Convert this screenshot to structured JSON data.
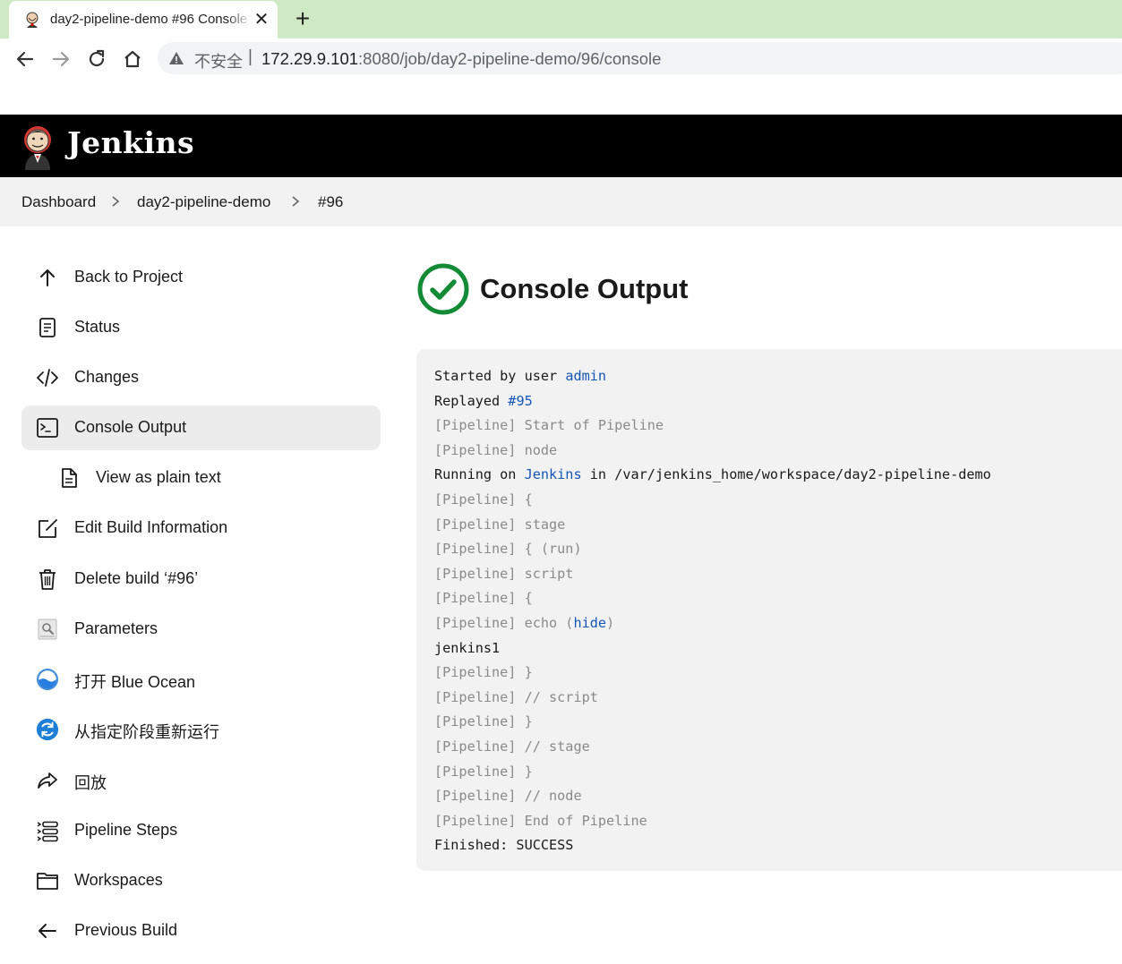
{
  "browser": {
    "tab_title": "day2-pipeline-demo #96 Console Output",
    "close_symbol": "✕",
    "new_tab_symbol": "+",
    "security_label": "不安全",
    "separator": "|",
    "url_host": "172.29.9.101",
    "url_path": ":8080/job/day2-pipeline-demo/96/console",
    "icons": [
      "back-arrow-icon",
      "forward-arrow-icon",
      "reload-icon",
      "home-icon",
      "warning-triangle-icon"
    ]
  },
  "header": {
    "title": "Jenkins",
    "logo": "jenkins-butler-logo"
  },
  "breadcrumb": [
    "Dashboard",
    "day2-pipeline-demo",
    "#96"
  ],
  "sidebar": {
    "items": [
      {
        "label": "Back to Project",
        "icon": "arrow-up-icon"
      },
      {
        "label": "Status",
        "icon": "document-icon"
      },
      {
        "label": "Changes",
        "icon": "code-icon"
      },
      {
        "label": "Console Output",
        "icon": "terminal-icon",
        "active": true
      },
      {
        "label": "View as plain text",
        "icon": "file-text-icon",
        "sub": true
      },
      {
        "label": "Edit Build Information",
        "icon": "edit-icon"
      },
      {
        "label": "Delete build ‘#96’",
        "icon": "trash-icon"
      },
      {
        "label": "Parameters",
        "icon": "parameters-icon"
      },
      {
        "label": "打开 Blue Ocean",
        "icon": "blue-ocean-icon"
      },
      {
        "label": "从指定阶段重新运行",
        "icon": "restart-stage-icon"
      },
      {
        "label": "回放",
        "icon": "replay-icon"
      },
      {
        "label": "Pipeline Steps",
        "icon": "list-icon"
      },
      {
        "label": "Workspaces",
        "icon": "folder-icon"
      },
      {
        "label": "Previous Build",
        "icon": "arrow-left-icon"
      }
    ]
  },
  "main": {
    "title": "Console Output",
    "status_icon": "success-check-icon",
    "status_color": "#138a36",
    "link_color": "#1456b8",
    "console_lines": [
      {
        "text": "Started by user ",
        "link": "admin"
      },
      {
        "text": "Replayed ",
        "link": "#95"
      },
      {
        "text": "[Pipeline] Start of Pipeline",
        "dim": true
      },
      {
        "text": "[Pipeline] node",
        "dim": true
      },
      {
        "text": "Running on ",
        "link": "Jenkins",
        "after": " in /var/jenkins_home/workspace/day2-pipeline-demo"
      },
      {
        "text": "[Pipeline] {",
        "dim": true
      },
      {
        "text": "[Pipeline] stage",
        "dim": true
      },
      {
        "text": "[Pipeline] { (run)",
        "dim": true
      },
      {
        "text": "[Pipeline] script",
        "dim": true
      },
      {
        "text": "[Pipeline] {",
        "dim": true
      },
      {
        "text": "[Pipeline] echo (",
        "link": "hide",
        "after": ")",
        "dim": true
      },
      {
        "text": "jenkins1"
      },
      {
        "text": "[Pipeline] }",
        "dim": true
      },
      {
        "text": "[Pipeline] // script",
        "dim": true
      },
      {
        "text": "[Pipeline] }",
        "dim": true
      },
      {
        "text": "[Pipeline] // stage",
        "dim": true
      },
      {
        "text": "[Pipeline] }",
        "dim": true
      },
      {
        "text": "[Pipeline] // node",
        "dim": true
      },
      {
        "text": "[Pipeline] End of Pipeline",
        "dim": true
      },
      {
        "text": "Finished: SUCCESS"
      }
    ]
  }
}
